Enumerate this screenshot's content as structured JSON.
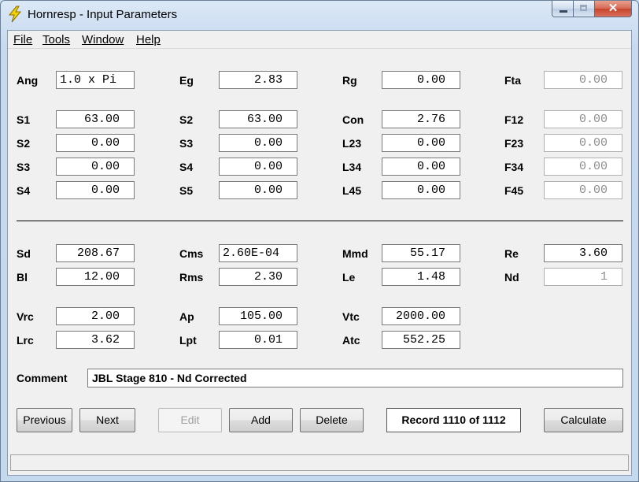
{
  "window": {
    "title": "Hornresp - Input Parameters"
  },
  "menu": [
    "File",
    "Tools",
    "Window",
    "Help"
  ],
  "rows": [
    [
      {
        "label": "Ang",
        "value": "1.0 x Pi",
        "align": "left"
      },
      {
        "label": "Eg",
        "value": "2.83"
      },
      {
        "label": "Rg",
        "value": "0.00"
      },
      {
        "label": "Fta",
        "value": "0.00",
        "disabled": true
      }
    ],
    [
      {
        "label": "S1",
        "value": "63.00"
      },
      {
        "label": "S2",
        "value": "63.00"
      },
      {
        "label": "Con",
        "value": "2.76"
      },
      {
        "label": "F12",
        "value": "0.00",
        "disabled": true
      }
    ],
    [
      {
        "label": "S2",
        "value": "0.00"
      },
      {
        "label": "S3",
        "value": "0.00"
      },
      {
        "label": "L23",
        "value": "0.00"
      },
      {
        "label": "F23",
        "value": "0.00",
        "disabled": true
      }
    ],
    [
      {
        "label": "S3",
        "value": "0.00"
      },
      {
        "label": "S4",
        "value": "0.00"
      },
      {
        "label": "L34",
        "value": "0.00"
      },
      {
        "label": "F34",
        "value": "0.00",
        "disabled": true
      }
    ],
    [
      {
        "label": "S4",
        "value": "0.00"
      },
      {
        "label": "S5",
        "value": "0.00"
      },
      {
        "label": "L45",
        "value": "0.00"
      },
      {
        "label": "F45",
        "value": "0.00",
        "disabled": true
      }
    ],
    [
      {
        "label": "Sd",
        "value": "208.67"
      },
      {
        "label": "Cms",
        "value": "2.60E-04",
        "align": "left"
      },
      {
        "label": "Mmd",
        "value": "55.17"
      },
      {
        "label": "Re",
        "value": "3.60"
      }
    ],
    [
      {
        "label": "Bl",
        "value": "12.00"
      },
      {
        "label": "Rms",
        "value": "2.30"
      },
      {
        "label": "Le",
        "value": "1.48"
      },
      {
        "label": "Nd",
        "value": "1",
        "disabled": true
      }
    ],
    [
      {
        "label": "Vrc",
        "value": "2.00"
      },
      {
        "label": "Ap",
        "value": "105.00"
      },
      {
        "label": "Vtc",
        "value": "2000.00"
      }
    ],
    [
      {
        "label": "Lrc",
        "value": "3.62"
      },
      {
        "label": "Lpt",
        "value": "0.01"
      },
      {
        "label": "Atc",
        "value": "552.25"
      }
    ]
  ],
  "comment": {
    "label": "Comment",
    "value": "JBL Stage 810 - Nd Corrected"
  },
  "buttons": {
    "previous": "Previous",
    "next": "Next",
    "edit": "Edit",
    "add": "Add",
    "delete": "Delete",
    "calculate": "Calculate"
  },
  "record": "Record 1110 of 1112"
}
